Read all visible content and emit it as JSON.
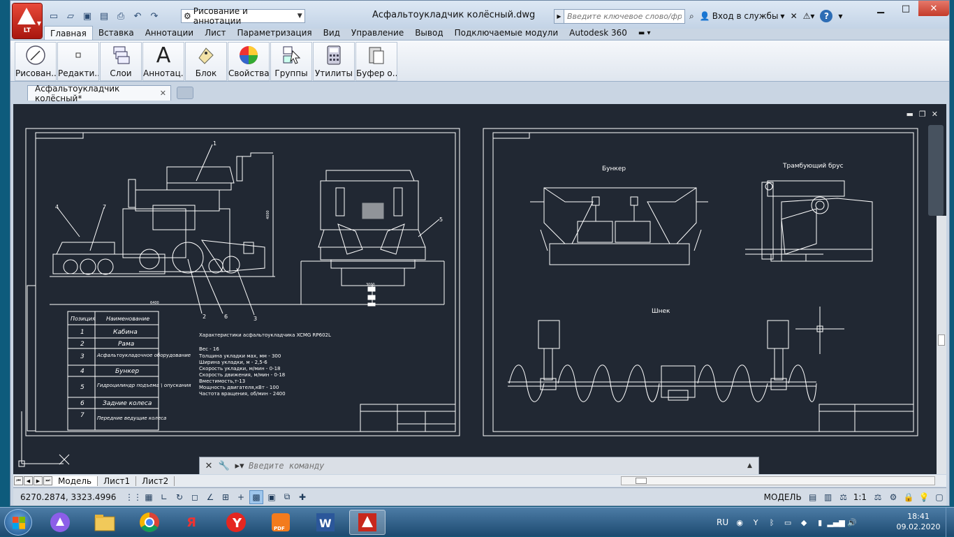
{
  "window": {
    "title": "Асфальтоукладчик колёсный.dwg",
    "app_badge": "LT",
    "workspace": "Рисование и аннотации",
    "search_placeholder": "Введите ключевое слово/фразу",
    "signin": "Вход в службы",
    "help": "?"
  },
  "ribbon": {
    "tabs": [
      "Главная",
      "Вставка",
      "Аннотации",
      "Лист",
      "Параметризация",
      "Вид",
      "Управление",
      "Вывод",
      "Подключаемые модули",
      "Autodesk 360"
    ],
    "buttons": [
      {
        "label": "Рисован...",
        "icon": "draw-icon"
      },
      {
        "label": "Редакти...",
        "icon": "modify-icon"
      },
      {
        "label": "Слои",
        "icon": "layers-icon"
      },
      {
        "label": "Аннотац...",
        "icon": "annotation-icon"
      },
      {
        "label": "Блок",
        "icon": "block-icon"
      },
      {
        "label": "Свойства",
        "icon": "properties-icon"
      },
      {
        "label": "Группы",
        "icon": "groups-icon"
      },
      {
        "label": "Утилиты",
        "icon": "utilities-icon"
      },
      {
        "label": "Буфер о...",
        "icon": "clipboard-icon"
      }
    ]
  },
  "file_tab": {
    "label": "Асфальтоукладчик колёсный*"
  },
  "drawing": {
    "sheet1": {
      "table_headers": [
        "Позиция",
        "Наименование"
      ],
      "table_rows": [
        [
          "1",
          "Кабина"
        ],
        [
          "2",
          "Рама"
        ],
        [
          "3",
          "Асфальтоукладочное оборудование"
        ],
        [
          "4",
          "Бункер"
        ],
        [
          "5",
          "Гидроцилиндр подъема \\ опускания"
        ],
        [
          "6",
          "Задние колеса"
        ],
        [
          "7",
          "Передние ведущие колеса"
        ]
      ],
      "specs_title": "Характеристики асфальтоукладчика XCMG RP602L",
      "specs": [
        "Вес - 16",
        "Толщина укладки мах, мм - 300",
        "Ширина укладки, м - 2,5-6",
        "Скорость укладки, м/мин - 0-18",
        "Скорость движения, м/мин - 0-18",
        "Вместимость,т-13",
        "Мощность двигателя,кВт - 100",
        "Частота вращения, об/мин - 2400"
      ],
      "callouts": [
        "1",
        "2",
        "3",
        "4",
        "5",
        "6",
        "7"
      ],
      "dim_length": "6400",
      "dim_height": "4000",
      "dim_width": "3000"
    },
    "sheet2": {
      "labels": {
        "hopper": "Бункер",
        "screed": "Трамбующий брус",
        "auger": "Шнек"
      }
    }
  },
  "command": {
    "placeholder": "Введите команду"
  },
  "layouts": {
    "tabs": [
      "Модель",
      "Лист1",
      "Лист2"
    ]
  },
  "status": {
    "coords": "6270.2874, 3323.4996",
    "model": "МОДЕЛЬ",
    "scale": "1:1"
  },
  "taskbar": {
    "lang": "RU",
    "time": "18:41",
    "date": "09.02.2020"
  },
  "colors": {
    "canvas": "#212833",
    "lines": "#ffffff",
    "accent_red": "#d9281c",
    "ribbon": "#dfe6ef"
  }
}
